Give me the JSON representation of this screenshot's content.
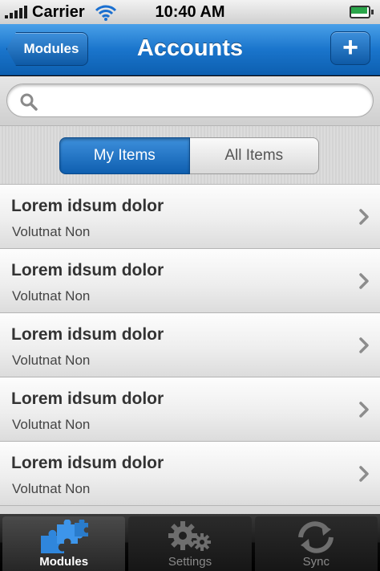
{
  "status_bar": {
    "carrier": "Carrier",
    "time": "10:40 AM",
    "icons": [
      "signal-icon",
      "wifi-icon",
      "battery-icon"
    ]
  },
  "nav_bar": {
    "back_label": "Modules",
    "title": "Accounts",
    "add_label": "+"
  },
  "search": {
    "placeholder": "",
    "value": "",
    "icon": "search-icon"
  },
  "segments": [
    {
      "label": "My Items",
      "selected": true
    },
    {
      "label": "All Items",
      "selected": false
    }
  ],
  "list": {
    "items": [
      {
        "title": "Lorem idsum dolor",
        "subtitle": "Volutnat Non"
      },
      {
        "title": "Lorem idsum dolor",
        "subtitle": "Volutnat Non"
      },
      {
        "title": "Lorem idsum dolor",
        "subtitle": "Volutnat Non"
      },
      {
        "title": "Lorem idsum dolor",
        "subtitle": "Volutnat Non"
      },
      {
        "title": "Lorem idsum dolor",
        "subtitle": "Volutnat Non"
      }
    ],
    "chevron_icon": "chevron-right-icon"
  },
  "tab_bar": {
    "tabs": [
      {
        "label": "Modules",
        "icon": "puzzle-icon",
        "selected": true
      },
      {
        "label": "Settings",
        "icon": "gears-icon",
        "selected": false
      },
      {
        "label": "Sync",
        "icon": "sync-icon",
        "selected": false
      }
    ]
  },
  "colors": {
    "nav_blue": "#1a75cc",
    "segment_active": "#2a7ccc",
    "tab_active_icon": "#3b8fe0"
  }
}
